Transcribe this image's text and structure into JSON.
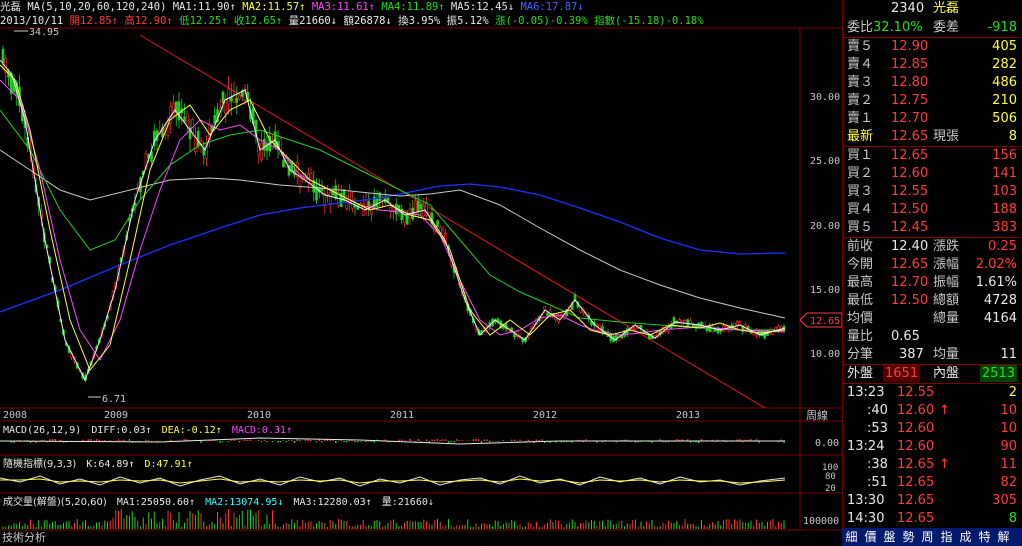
{
  "header": {
    "stock_name": "光磊",
    "ma_params": "MA(5,10,20,60,120,240)",
    "ma1": "MA1:11.90↑",
    "ma2": "MA2:11.57↑",
    "ma3": "MA3:11.61↑",
    "ma4": "MA4:11.89↑",
    "ma5": "MA5:12.45↓",
    "ma6": "MA6:17.87↓",
    "date": "2013/10/11",
    "open": "開12.85↑",
    "high": "高12.90↑",
    "low": "低12.25↑",
    "close": "收12.65↑",
    "volume": "量21660↓",
    "amount": "額26878↓",
    "turnover": "換3.95%",
    "amplitude": "振5.12%",
    "change": "漲(-0.05)-0.39%",
    "index": "指數(-15.18)-0.18%"
  },
  "main_chart": {
    "price_ticks": [
      "30.00",
      "25.00",
      "20.00",
      "15.00",
      "10.00"
    ],
    "year_labels": [
      "2008",
      "2009",
      "2010",
      "2011",
      "2012",
      "2013"
    ],
    "period_label": "周線",
    "high_marker": "34.95",
    "low_marker": "6.71",
    "current_price": "12.65"
  },
  "macd_panel": {
    "title": "MACD(26,12,9)",
    "diff": "DIFF:0.03↑",
    "dea": "DEA:-0.12↑",
    "macd": "MACD:0.31↑",
    "tick": "0.00"
  },
  "kd_panel": {
    "title": "隨機指標(9,3,3)",
    "k": "K:64.89↑",
    "d": "D:47.91↑",
    "ticks": [
      "100",
      "80",
      "20"
    ]
  },
  "volume_panel": {
    "title": "成交量(解盤)(5,20,60)",
    "ma1": "MA1:25050.60↑",
    "ma2": "MA2:13074.95↓",
    "ma3": "MA3:12280.03↑",
    "vol": "量:21660↓",
    "tick": "100000"
  },
  "footer": {
    "label": "技術分析"
  },
  "quote": {
    "code": "2340",
    "name": "光磊",
    "ratio_label": "委比",
    "ratio": "32.10%",
    "diff_label": "委差",
    "diff": "-918",
    "asks": [
      {
        "label": "賣５",
        "price": "12.90",
        "vol": "405"
      },
      {
        "label": "賣４",
        "price": "12.85",
        "vol": "282"
      },
      {
        "label": "賣３",
        "price": "12.80",
        "vol": "486"
      },
      {
        "label": "賣２",
        "price": "12.75",
        "vol": "210"
      },
      {
        "label": "賣１",
        "price": "12.70",
        "vol": "506"
      }
    ],
    "last_label": "最新",
    "last": "12.65",
    "now_vol_label": "現張",
    "now_vol": "8",
    "bids": [
      {
        "label": "買１",
        "price": "12.65",
        "vol": "156"
      },
      {
        "label": "買２",
        "price": "12.60",
        "vol": "141"
      },
      {
        "label": "買３",
        "price": "12.55",
        "vol": "103"
      },
      {
        "label": "買４",
        "price": "12.50",
        "vol": "188"
      },
      {
        "label": "買５",
        "price": "12.45",
        "vol": "383"
      }
    ],
    "stats": [
      {
        "l1": "前收",
        "v1": "12.40",
        "l2": "漲跌",
        "v2": "0.25"
      },
      {
        "l1": "今開",
        "v1": "12.65",
        "l2": "漲幅",
        "v2": "2.02%"
      },
      {
        "l1": "最高",
        "v1": "12.70",
        "l2": "振幅",
        "v2": "1.61%"
      },
      {
        "l1": "最低",
        "v1": "12.50",
        "l2": "總額",
        "v2": "4728"
      },
      {
        "l1": "均價",
        "v1": "",
        "l2": "總量",
        "v2": "4164"
      }
    ],
    "vol_ratio_label": "量比",
    "vol_ratio": "0.65",
    "tick_count_label": "分筆",
    "tick_count": "387",
    "avg_vol_label": "均量",
    "avg_vol": "11",
    "outer_label": "外盤",
    "outer": "1651",
    "inner_label": "內盤",
    "inner": "2513",
    "ticks": [
      {
        "time": "13:23",
        "price": "12.55",
        "arrow": "",
        "vol": "2"
      },
      {
        "time": ":40",
        "price": "12.60",
        "arrow": "↑",
        "vol": "10"
      },
      {
        "time": ":53",
        "price": "12.60",
        "arrow": "",
        "vol": "10"
      },
      {
        "time": "13:24",
        "price": "12.60",
        "arrow": "",
        "vol": "90"
      },
      {
        "time": ":38",
        "price": "12.65",
        "arrow": "↑",
        "vol": "11"
      },
      {
        "time": ":51",
        "price": "12.65",
        "arrow": "",
        "vol": "82"
      },
      {
        "time": "13:30",
        "price": "12.65",
        "arrow": "",
        "vol": "305"
      },
      {
        "time": "14:30",
        "price": "12.65",
        "arrow": "",
        "vol": "8"
      }
    ]
  },
  "bottom_tabs": [
    "細",
    "價",
    "盤",
    "勢",
    "周",
    "指",
    "成",
    "特",
    "解"
  ]
}
